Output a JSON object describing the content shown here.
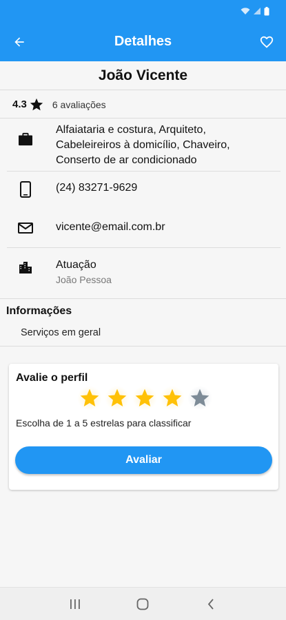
{
  "appbar": {
    "title": "Detalhes",
    "color": "#2196f3"
  },
  "profile": {
    "name": "João Vicente",
    "rating": "4.3",
    "reviews": "6 avaliações"
  },
  "details": {
    "services": "Alfaiataria e costura, Arquiteto, Cabeleireiros à domicílio, Chaveiro, Conserto de ar condicionado",
    "phone": "(24) 83271-9629",
    "email": "vicente@email.com.br",
    "area_label": "Atuação",
    "area_value": "João Pessoa"
  },
  "info": {
    "title": "Informações",
    "text": "Serviços em geral"
  },
  "review_card": {
    "title": "Avalie o perfil",
    "selected_stars": 4,
    "max_stars": 5,
    "hint": "Escolha de 1 a 5 estrelas para classificar",
    "button_label": "Avaliar",
    "star_on_color": "#ffc107",
    "star_off_color": "#7d8b97"
  },
  "icons": {
    "back": "arrow-left-icon",
    "favorite": "heart-outline-icon",
    "services": "briefcase-icon",
    "phone": "smartphone-icon",
    "email": "mail-icon",
    "area": "city-icon"
  }
}
